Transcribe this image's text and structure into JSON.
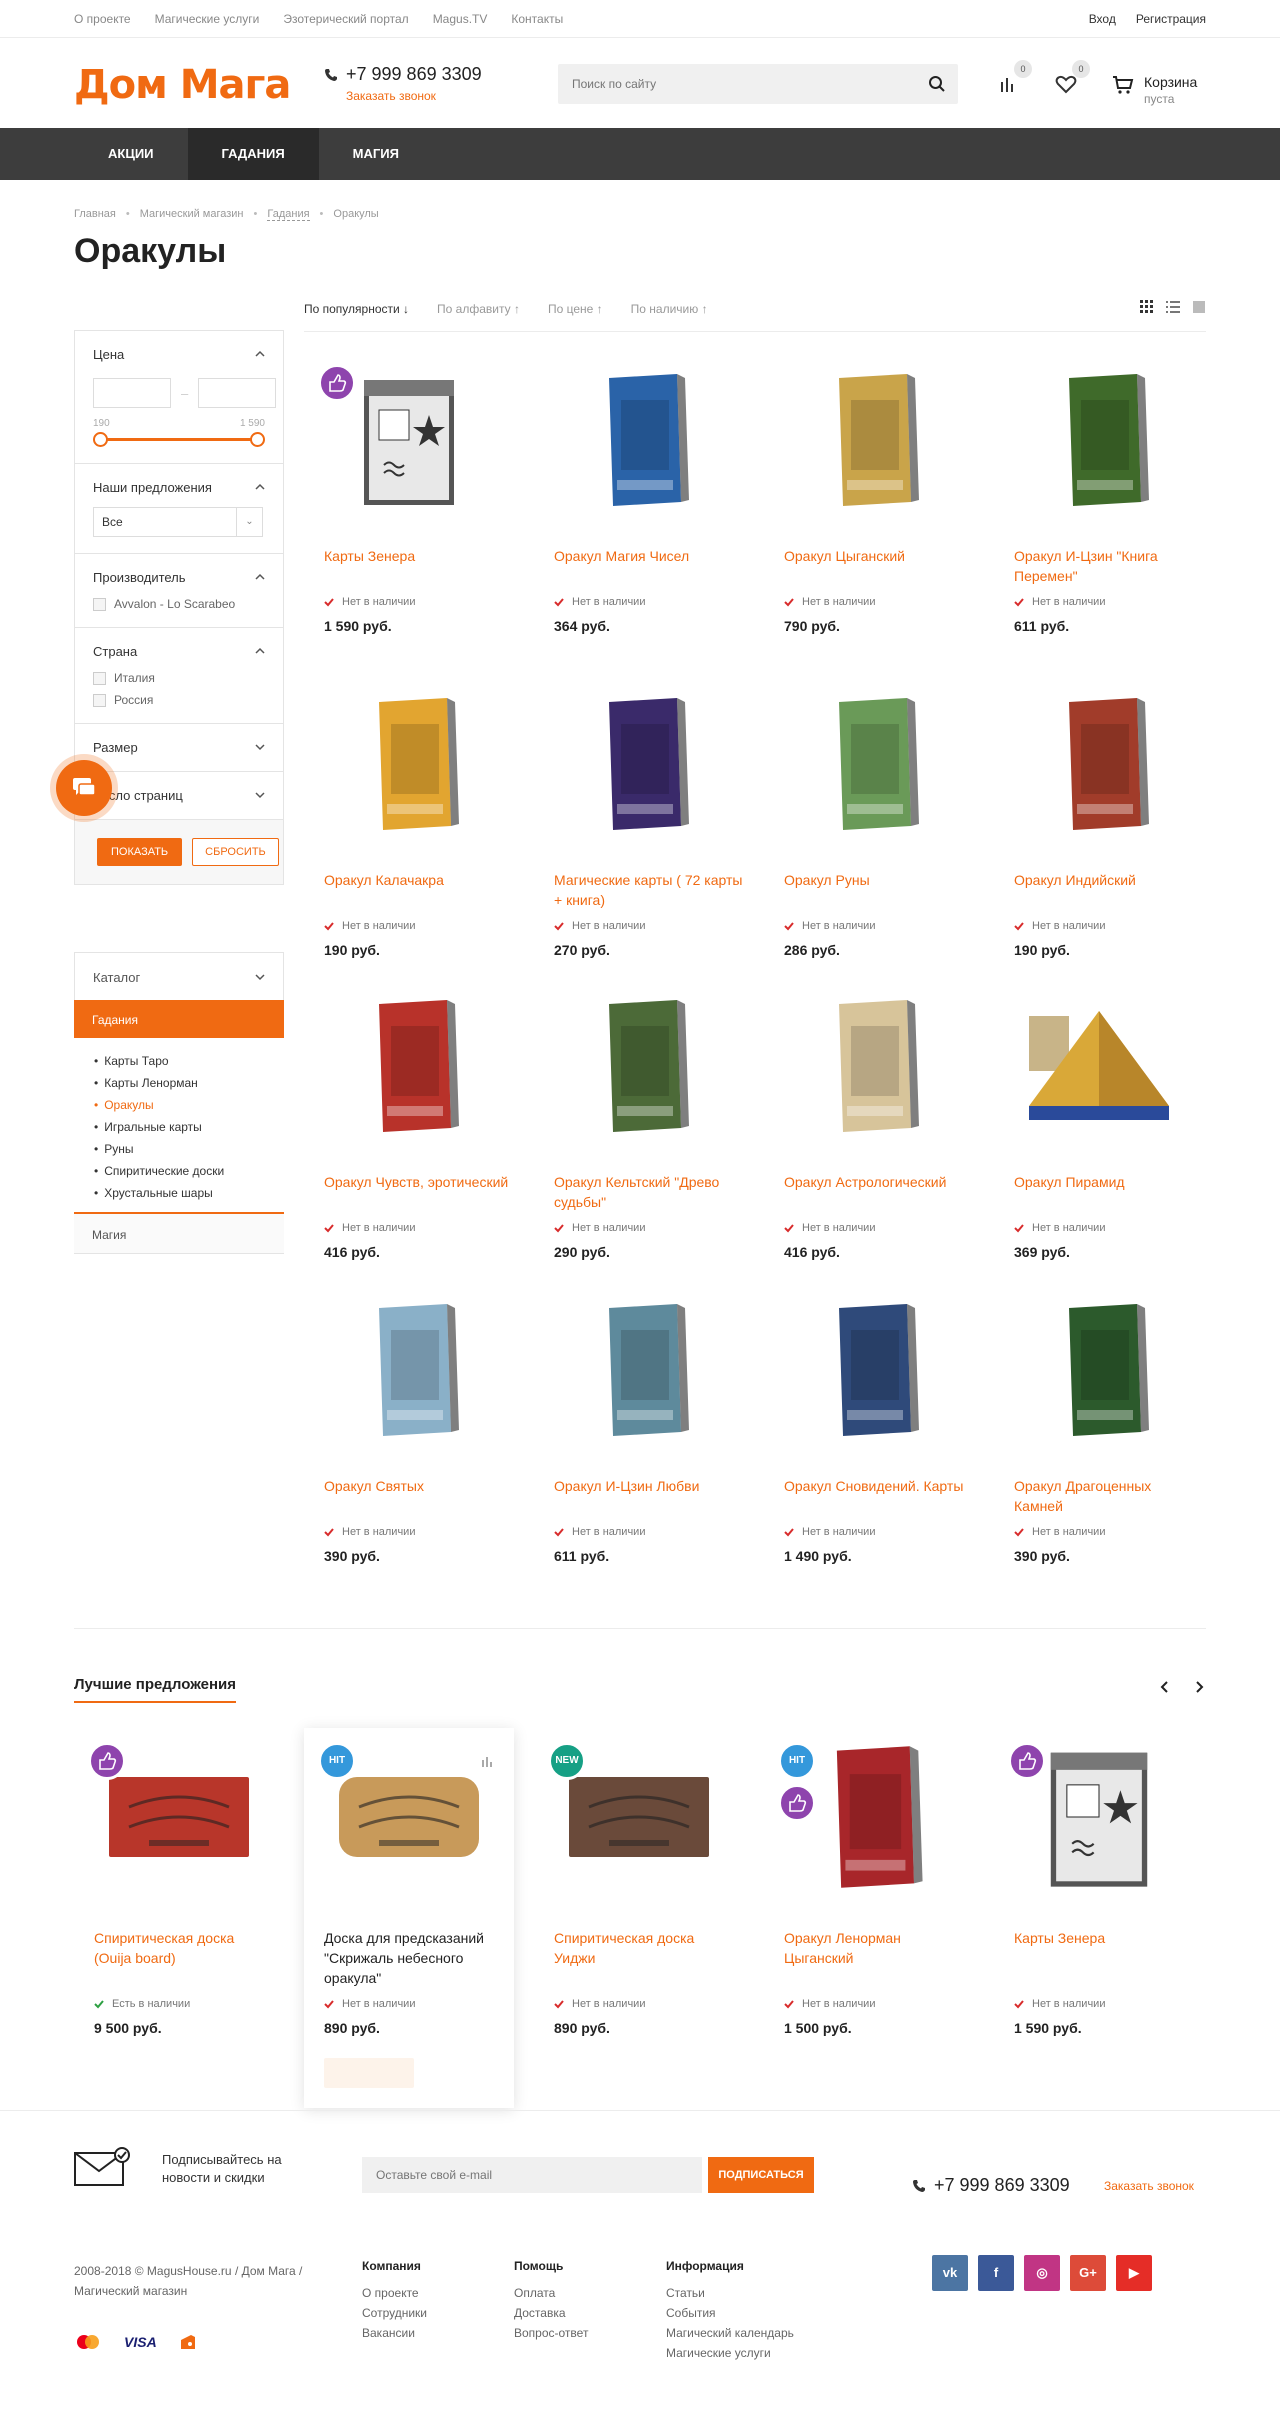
{
  "topbar": {
    "links": [
      "О проекте",
      "Магические услуги",
      "Эзотерический портал",
      "Magus.TV",
      "Контакты"
    ],
    "login": "Вход",
    "register": "Регистрация"
  },
  "header": {
    "logo": "Дом Мага",
    "phone": "+7 999 869 3309",
    "callback": "Заказать звонок",
    "search_placeholder": "Поиск по сайту",
    "compare_count": "0",
    "favorites_count": "0",
    "cart_title": "Корзина",
    "cart_status": "пуста"
  },
  "nav": [
    "АКЦИИ",
    "ГАДАНИЯ",
    "МАГИЯ"
  ],
  "breadcrumb": [
    "Главная",
    "Магический магазин",
    "Гадания",
    "Оракулы"
  ],
  "page_title": "Оракулы",
  "sort": [
    "По популярности ↓",
    "По алфавиту ↑",
    "По цене ↑",
    "По наличию ↑"
  ],
  "filters": {
    "price_title": "Цена",
    "price_min": "190",
    "price_max": "1 590",
    "offers_title": "Наши предложения",
    "offers_value": "Все",
    "maker_title": "Производитель",
    "maker_option": "Avvalon - Lo Scarabeo",
    "country_title": "Страна",
    "country_options": [
      "Италия",
      "Россия"
    ],
    "size_title": "Размер",
    "pages_title": "Число страниц",
    "show_btn": "ПОКАЗАТЬ",
    "reset_btn": "СБРОСИТЬ"
  },
  "catalog": {
    "title": "Каталог",
    "active": "Гадания",
    "items": [
      "Карты Таро",
      "Карты Ленорман",
      "Оракулы",
      "Игральные карты",
      "Руны",
      "Спиритические доски",
      "Хрустальные шары"
    ],
    "bottom": "Магия"
  },
  "stock_text": "Нет в наличии",
  "products": [
    {
      "name": "Карты Зенера",
      "price": "1 590 руб.",
      "color": "#6a6a6a",
      "art": "zener"
    },
    {
      "name": "Оракул Магия Чисел",
      "price": "364 руб.",
      "color": "#2a63a8",
      "art": "box"
    },
    {
      "name": "Оракул Цыганский",
      "price": "790 руб.",
      "color": "#c9a44a",
      "art": "box"
    },
    {
      "name": "Оракул И-Цзин \"Книга Перемен\"",
      "price": "611 руб.",
      "color": "#3f6a2a",
      "art": "box"
    },
    {
      "name": "Оракул Калачакра",
      "price": "190 руб.",
      "color": "#e2a530",
      "art": "box"
    },
    {
      "name": "Магические карты ( 72 карты + книга)",
      "price": "270 руб.",
      "color": "#3a2a6a",
      "art": "box"
    },
    {
      "name": "Оракул Руны",
      "price": "286 руб.",
      "color": "#6a9a58",
      "art": "box"
    },
    {
      "name": "Оракул Индийский",
      "price": "190 руб.",
      "color": "#a13c2a",
      "art": "box"
    },
    {
      "name": "Оракул Чувств, эротический",
      "price": "416 руб.",
      "color": "#b8322a",
      "art": "box"
    },
    {
      "name": "Оракул Кельтский \"Древо судьбы\"",
      "price": "290 руб.",
      "color": "#4c6a38",
      "art": "box"
    },
    {
      "name": "Оракул Астрологический",
      "price": "416 руб.",
      "color": "#d7c49a",
      "art": "box"
    },
    {
      "name": "Оракул Пирамид",
      "price": "369 руб.",
      "color": "#d9a838",
      "art": "pyramid"
    },
    {
      "name": "Оракул Святых",
      "price": "390 руб.",
      "color": "#8ab0c8",
      "art": "box"
    },
    {
      "name": "Оракул И-Цзин Любви",
      "price": "611 руб.",
      "color": "#5e8a9c",
      "art": "box"
    },
    {
      "name": "Оракул Сновидений. Карты",
      "price": "1 490 руб.",
      "color": "#2f4a7a",
      "art": "box"
    },
    {
      "name": "Оракул Драгоценных Камней",
      "price": "390 руб.",
      "color": "#2c5a2c",
      "art": "box"
    }
  ],
  "best": {
    "title": "Лучшие предложения",
    "items": [
      {
        "name": "Спиритическая доска (Ouija board)",
        "stock": "Есть в наличии",
        "price": "9 500 руб.",
        "badge": "like",
        "color": "#b8362a",
        "in_stock": true
      },
      {
        "name": "Доска для предсказаний \"Скрижаль небесного оракула\"",
        "stock": "Нет в наличии",
        "price": "890 руб.",
        "badge": "HIT",
        "color": "#c89a5a",
        "in_stock": false
      },
      {
        "name": "Спиритическая доска Уиджи",
        "stock": "Нет в наличии",
        "price": "890 руб.",
        "badge": "NEW",
        "color": "#6a4a3a",
        "in_stock": false
      },
      {
        "name": "Оракул Ленорман Цыганский",
        "stock": "Нет в наличии",
        "price": "1 500 руб.",
        "badge": "HIT+like",
        "color": "#a8262a",
        "in_stock": false
      },
      {
        "name": "Карты Зенера",
        "stock": "Нет в наличии",
        "price": "1 590 руб.",
        "badge": "like",
        "color": "#6a6a6a",
        "in_stock": false
      }
    ]
  },
  "footer": {
    "subscribe_text": "Подписывайтесь на новости и скидки",
    "email_placeholder": "Оставьте свой e-mail",
    "subscribe_btn": "ПОДПИСАТЬСЯ",
    "phone": "+7 999 869 3309",
    "callback": "Заказать звонок",
    "copyright": "2008-2018 © MagusHouse.ru / Дом Мага / Магический магазин",
    "columns": [
      {
        "title": "Компания",
        "links": [
          "О проекте",
          "Сотрудники",
          "Вакансии"
        ]
      },
      {
        "title": "Помощь",
        "links": [
          "Оплата",
          "Доставка",
          "Вопрос-ответ"
        ]
      },
      {
        "title": "Информация",
        "links": [
          "Статьи",
          "События",
          "Магический календарь",
          "Магические услуги"
        ]
      }
    ],
    "social": [
      {
        "name": "vk",
        "label": "vk",
        "color": "#4c75a3"
      },
      {
        "name": "facebook",
        "label": "f",
        "color": "#3b5998"
      },
      {
        "name": "instagram",
        "label": "◎",
        "color": "#c13584"
      },
      {
        "name": "google-plus",
        "label": "G+",
        "color": "#dd4b39"
      },
      {
        "name": "youtube",
        "label": "▶",
        "color": "#e52d27"
      }
    ],
    "payments": [
      "VISA"
    ]
  },
  "colors": {
    "accent": "#f06a12",
    "nav_bg": "#3d3d3d",
    "like_badge": "#8e44ad",
    "hit_badge": "#3498db",
    "new_badge": "#16a085"
  }
}
